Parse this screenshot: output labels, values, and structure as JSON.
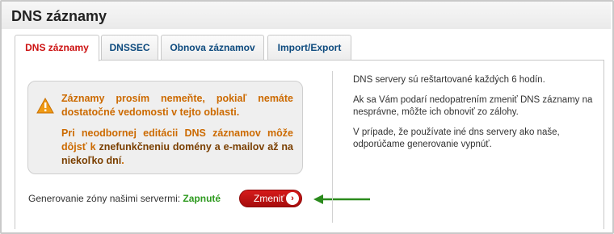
{
  "page": {
    "title": "DNS záznamy"
  },
  "tabs": [
    {
      "label": "DNS záznamy",
      "active": true
    },
    {
      "label": "DNSSEC",
      "active": false
    },
    {
      "label": "Obnova záznamov",
      "active": false
    },
    {
      "label": "Import/Export",
      "active": false
    }
  ],
  "warning": {
    "icon": "warning-triangle-icon",
    "paragraph1": "Záznamy prosím nemeňte, pokiaľ nemáte dostatočné vedomosti v tejto oblasti.",
    "paragraph2_prefix": "Pri neodbornej editácii DNS záznamov môže dôjsť k ",
    "paragraph2_bold": "znefunkčneniu domény a e-mailov až na niekoľko dní",
    "paragraph2_suffix": "."
  },
  "generation": {
    "label": "Generovanie zóny našimi servermi:",
    "status": "Zapnuté",
    "button_label": "Zmeniť"
  },
  "info": {
    "line1": "DNS servery sú reštartované každých 6 hodín.",
    "line2": "Ak sa Vám podarí nedopatrením zmeniť DNS záznamy na nesprávne, môžte ich obnoviť zo zálohy.",
    "line3": "V prípade, že používate iné dns servery ako naše, odporúčame generovanie vypnúť."
  },
  "colors": {
    "active_tab": "#cc1111",
    "tab_text": "#0d4a7e",
    "warning_text": "#cc6a00",
    "status_on": "#2e9a1f",
    "button": "#c41515",
    "arrow": "#2a8a1c"
  }
}
